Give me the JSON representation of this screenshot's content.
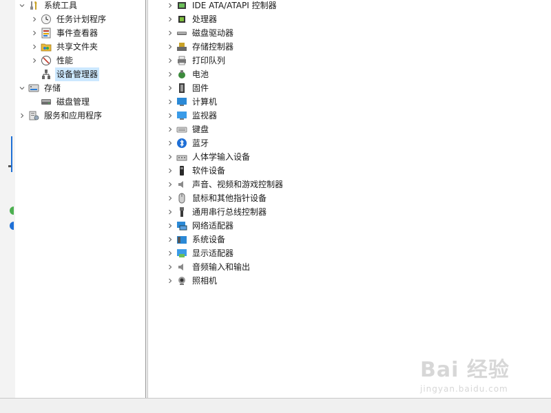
{
  "left_tree": {
    "items": [
      {
        "label": "系统工具",
        "icon": "system-tools-icon",
        "expander": "expanded"
      },
      {
        "label": "任务计划程序",
        "icon": "task-scheduler-icon",
        "expander": "collapsed"
      },
      {
        "label": "事件查看器",
        "icon": "event-viewer-icon",
        "expander": "collapsed"
      },
      {
        "label": "共享文件夹",
        "icon": "shared-folders-icon",
        "expander": "collapsed"
      },
      {
        "label": "性能",
        "icon": "performance-icon",
        "expander": "collapsed"
      },
      {
        "label": "设备管理器",
        "icon": "device-manager-icon",
        "expander": "none",
        "selected": true
      },
      {
        "label": "存储",
        "icon": "storage-icon",
        "expander": "expanded"
      },
      {
        "label": "磁盘管理",
        "icon": "disk-management-icon",
        "expander": "none"
      },
      {
        "label": "服务和应用程序",
        "icon": "services-apps-icon",
        "expander": "collapsed"
      }
    ]
  },
  "device_tree": {
    "items": [
      {
        "label": "IDE ATA/ATAPI 控制器",
        "icon": "ide-controller-icon"
      },
      {
        "label": "处理器",
        "icon": "processor-icon"
      },
      {
        "label": "磁盘驱动器",
        "icon": "disk-drive-icon"
      },
      {
        "label": "存储控制器",
        "icon": "storage-controller-icon"
      },
      {
        "label": "打印队列",
        "icon": "print-queue-icon"
      },
      {
        "label": "电池",
        "icon": "battery-icon"
      },
      {
        "label": "固件",
        "icon": "firmware-icon"
      },
      {
        "label": "计算机",
        "icon": "computer-icon"
      },
      {
        "label": "监视器",
        "icon": "monitor-icon"
      },
      {
        "label": "键盘",
        "icon": "keyboard-icon"
      },
      {
        "label": "蓝牙",
        "icon": "bluetooth-icon"
      },
      {
        "label": "人体学输入设备",
        "icon": "hid-icon"
      },
      {
        "label": "软件设备",
        "icon": "software-device-icon"
      },
      {
        "label": "声音、视频和游戏控制器",
        "icon": "sound-video-icon"
      },
      {
        "label": "鼠标和其他指针设备",
        "icon": "mouse-icon"
      },
      {
        "label": "通用串行总线控制器",
        "icon": "usb-icon"
      },
      {
        "label": "网络适配器",
        "icon": "network-adapter-icon"
      },
      {
        "label": "系统设备",
        "icon": "system-device-icon"
      },
      {
        "label": "显示适配器",
        "icon": "display-adapter-icon"
      },
      {
        "label": "音频输入和输出",
        "icon": "audio-io-icon"
      },
      {
        "label": "照相机",
        "icon": "camera-icon"
      }
    ]
  },
  "watermark": {
    "main": "Bai 经验",
    "sub": "jingyan.baidu.com"
  },
  "colors": {
    "selection": "#cce8ff",
    "accent": "#1e6fd6"
  }
}
